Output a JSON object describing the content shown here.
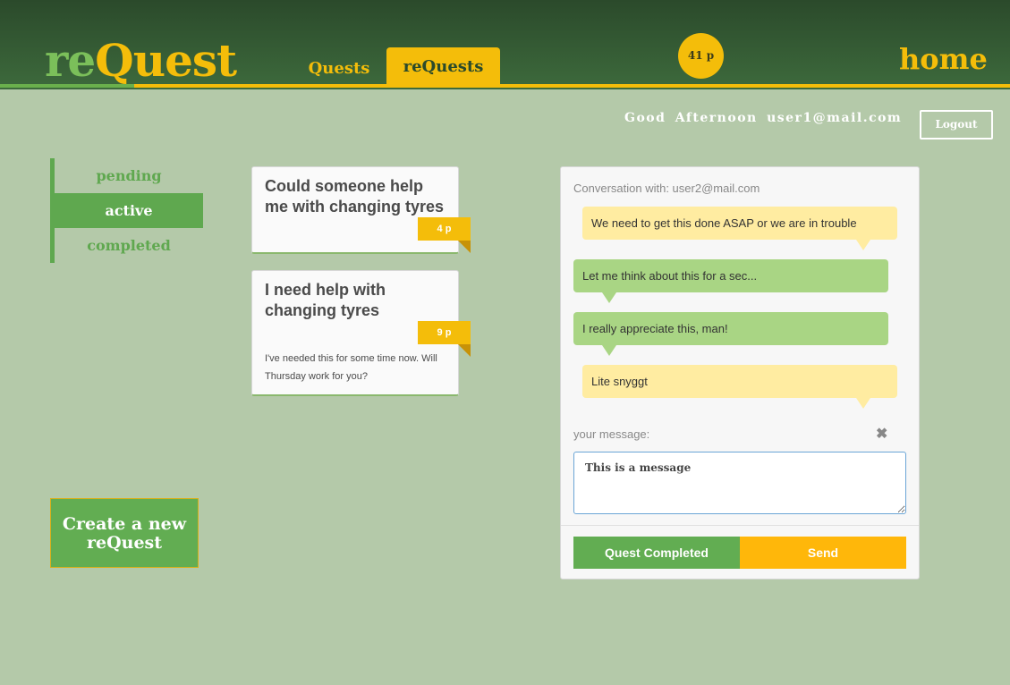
{
  "header": {
    "logo_re": "re",
    "logo_quest": "Quest",
    "tabs": [
      {
        "label": "Quests"
      },
      {
        "label": "reQuests"
      }
    ],
    "points": "41 p",
    "home_label": "home"
  },
  "user": {
    "greeting": "Good Afternoon",
    "email": "user1@mail.com",
    "logout_label": "Logout"
  },
  "filters": [
    {
      "label": "pending"
    },
    {
      "label": "active"
    },
    {
      "label": "completed"
    }
  ],
  "quests": [
    {
      "title": "Could someone help me with changing tyres",
      "points": "4 p",
      "description": ""
    },
    {
      "title": "I need help with changing tyres",
      "points": "9 p",
      "description": "I've needed this for some time now. Will Thursday work for you?"
    }
  ],
  "create_button_label": "Create a new reQuest",
  "conversation": {
    "header": "Conversation with: user2@mail.com",
    "messages": [
      {
        "text": "We need to get this done ASAP or we are in trouble",
        "side": "right"
      },
      {
        "text": "Let me think about this for a sec...",
        "side": "left"
      },
      {
        "text": "I really appreciate this, man!",
        "side": "left"
      },
      {
        "text": "Lite snyggt",
        "side": "right"
      }
    ],
    "input_label": "your message:",
    "input_value": "This is a message",
    "completed_label": "Quest Completed",
    "send_label": "Send"
  },
  "colors": {
    "header_bg": "#2b4a2b",
    "accent_yellow": "#f4bd0a",
    "accent_green": "#5fa84f",
    "page_bg": "#b4c9a9"
  },
  "icons": {
    "clear": "close-icon"
  }
}
